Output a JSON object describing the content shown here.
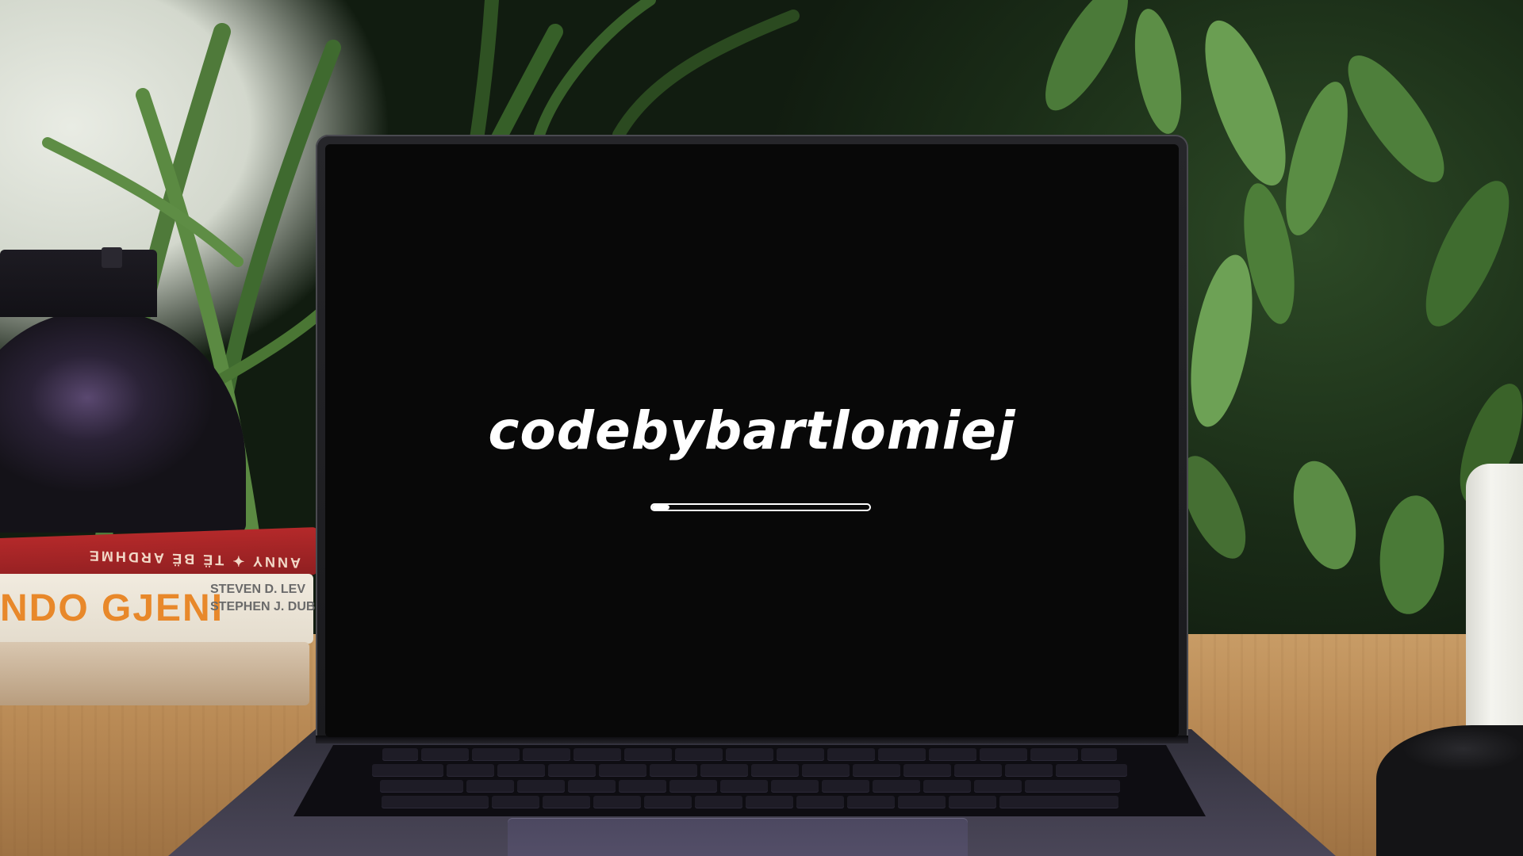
{
  "screen": {
    "brand_text": "codebybartlomiej",
    "progress_fraction": 0.08
  },
  "background_objects": {
    "book_red_spine_text": "ANNY ✦ TË BË ARDHME",
    "book_white_title": "NDO GJENI",
    "book_white_authors": [
      "STEVEN D. LEV",
      "STEPHEN J. DUB"
    ]
  },
  "colors": {
    "screen_bg": "#080808",
    "brand_text": "#ffffff",
    "progress": "#ffffff"
  }
}
